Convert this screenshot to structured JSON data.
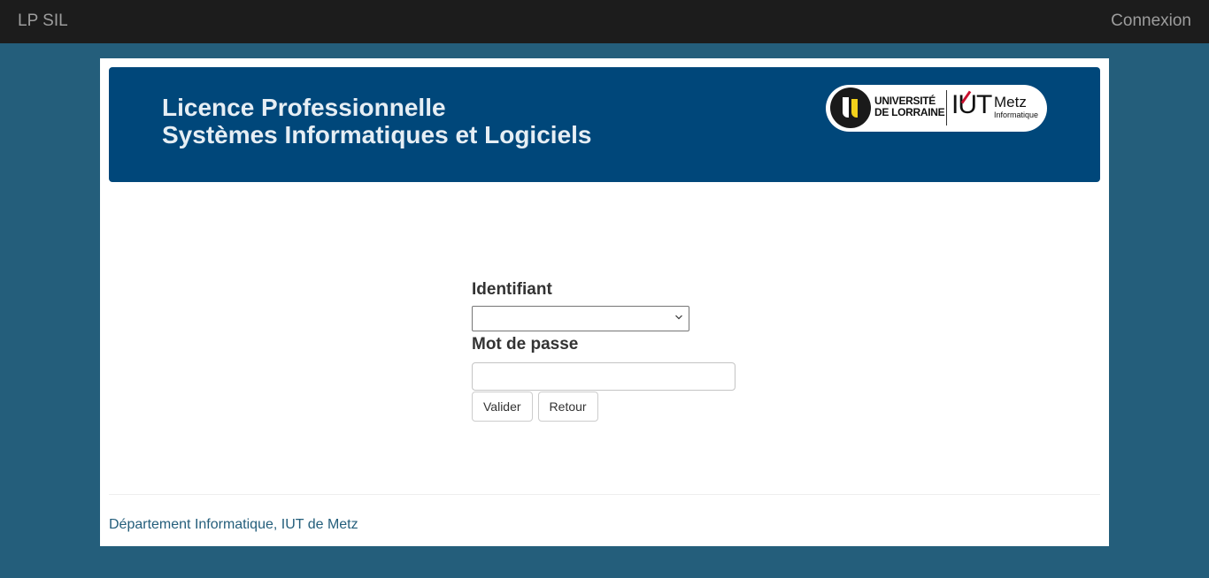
{
  "navbar": {
    "brand": "LP SIL",
    "login_link": "Connexion"
  },
  "banner": {
    "title_line1": "Licence Professionnelle",
    "title_line2": "Systèmes Informatiques et Logiciels",
    "logo": {
      "university_line1": "UNIVERSITÉ",
      "university_line2": "DE LORRAINE",
      "iut": "IUT",
      "city": "Metz",
      "department": "Informatique"
    }
  },
  "form": {
    "identifier_label": "Identifiant",
    "identifier_value": "",
    "password_label": "Mot de passe",
    "password_value": "",
    "submit_label": "Valider",
    "back_label": "Retour"
  },
  "footer": {
    "text": "Département Informatique, IUT de Metz"
  },
  "colors": {
    "page_background": "#245e7b",
    "navbar": "#1c1c1c",
    "banner": "#00477a",
    "footer_text": "#245e7b",
    "logo_yellow": "#f3d11b",
    "logo_red": "#c8102e"
  },
  "icons": {
    "select_arrow": "chevron-down-icon"
  }
}
